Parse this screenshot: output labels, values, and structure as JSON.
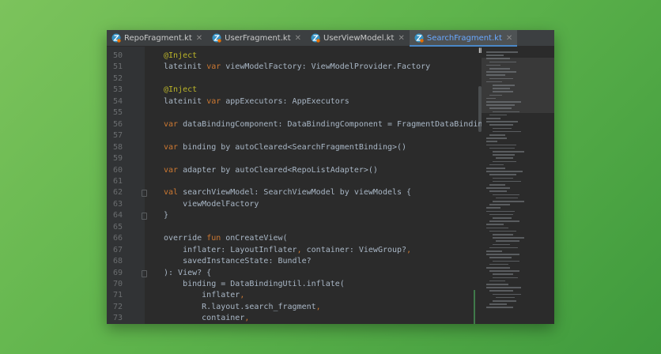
{
  "tabs": [
    {
      "label": "RepoFragment.kt",
      "active": false
    },
    {
      "label": "UserFragment.kt",
      "active": false
    },
    {
      "label": "UserViewModel.kt",
      "active": false
    },
    {
      "label": "SearchFragment.kt",
      "active": true
    }
  ],
  "tab_close_glyph": "✕",
  "colors": {
    "keyword": "#cc7832",
    "annotation": "#bbb529",
    "text": "#a9b7c6",
    "active_tab_text": "#6aa9ff",
    "line_number": "#6b6e70"
  },
  "code_lines": [
    {
      "num": "50",
      "parts": [
        {
          "t": "@Inject",
          "k": "ann"
        }
      ]
    },
    {
      "num": "51",
      "parts": [
        {
          "t": "lateinit "
        },
        {
          "t": "var",
          "k": "kw"
        },
        {
          "t": " viewModelFactory: ViewModelProvider.Factory"
        }
      ]
    },
    {
      "num": "52",
      "parts": []
    },
    {
      "num": "53",
      "parts": [
        {
          "t": "@Inject",
          "k": "ann"
        }
      ]
    },
    {
      "num": "54",
      "parts": [
        {
          "t": "lateinit "
        },
        {
          "t": "var",
          "k": "kw"
        },
        {
          "t": " appExecutors: AppExecutors"
        }
      ]
    },
    {
      "num": "55",
      "parts": []
    },
    {
      "num": "56",
      "parts": [
        {
          "t": "var",
          "k": "kw"
        },
        {
          "t": " dataBindingComponent: DataBindingComponent = FragmentDataBindingCompo"
        }
      ]
    },
    {
      "num": "57",
      "parts": []
    },
    {
      "num": "58",
      "parts": [
        {
          "t": "var",
          "k": "kw"
        },
        {
          "t": " binding by autoCleared<SearchFragmentBinding>()"
        }
      ]
    },
    {
      "num": "59",
      "parts": []
    },
    {
      "num": "60",
      "parts": [
        {
          "t": "var",
          "k": "kw"
        },
        {
          "t": " adapter by autoCleared<RepoListAdapter>()"
        }
      ]
    },
    {
      "num": "61",
      "parts": []
    },
    {
      "num": "62",
      "parts": [
        {
          "t": "val",
          "k": "kw"
        },
        {
          "t": " searchViewModel: SearchViewModel by viewModels {"
        }
      ],
      "fold": true
    },
    {
      "num": "63",
      "parts": [
        {
          "t": "    viewModelFactory"
        }
      ]
    },
    {
      "num": "64",
      "parts": [
        {
          "t": "}"
        }
      ],
      "fold": true
    },
    {
      "num": "65",
      "parts": []
    },
    {
      "num": "66",
      "parts": [
        {
          "t": "override "
        },
        {
          "t": "fun",
          "k": "kw"
        },
        {
          "t": " onCreateView("
        }
      ]
    },
    {
      "num": "67",
      "parts": [
        {
          "t": "    inflater: LayoutInflater"
        },
        {
          "t": ",",
          "k": "kw"
        },
        {
          "t": " container: ViewGroup?"
        },
        {
          "t": ",",
          "k": "kw"
        }
      ]
    },
    {
      "num": "68",
      "parts": [
        {
          "t": "    savedInstanceState: Bundle?"
        }
      ]
    },
    {
      "num": "69",
      "parts": [
        {
          "t": "): View? {"
        }
      ],
      "fold": true
    },
    {
      "num": "70",
      "parts": [
        {
          "t": "    binding = DataBindingUtil.inflate("
        }
      ]
    },
    {
      "num": "71",
      "parts": [
        {
          "t": "        inflater"
        },
        {
          "t": ",",
          "k": "kw"
        }
      ]
    },
    {
      "num": "72",
      "parts": [
        {
          "t": "        R.layout.search_fragment"
        },
        {
          "t": ",",
          "k": "kw"
        }
      ]
    },
    {
      "num": "73",
      "parts": [
        {
          "t": "        container"
        },
        {
          "t": ",",
          "k": "kw"
        }
      ]
    }
  ],
  "pause_glyph": "II"
}
